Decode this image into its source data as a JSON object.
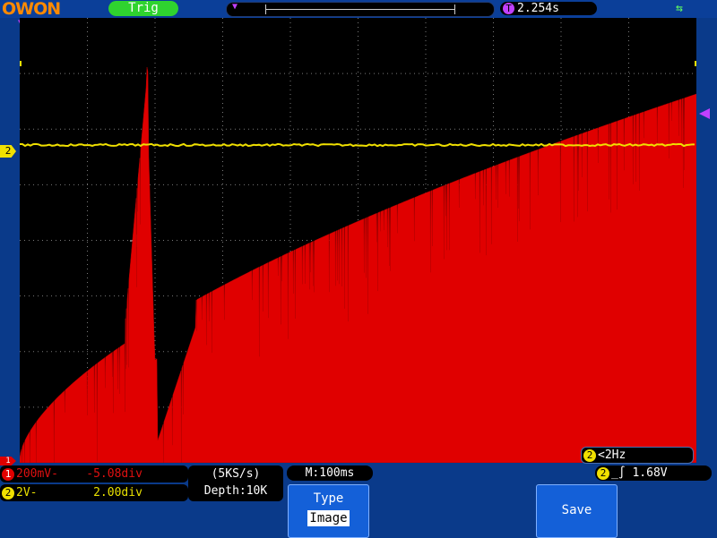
{
  "header": {
    "logo": "OWON",
    "trigger_status": "Trig",
    "trigger_time_offset": "2.254s",
    "trigger_marker_label": "T"
  },
  "channels": {
    "ch1": {
      "number": "1",
      "scale": "200mV-",
      "position": "-5.08div",
      "color": "#e00000"
    },
    "ch2": {
      "number": "2",
      "scale": "2V-",
      "position": "2.00div",
      "color": "#f0e000"
    }
  },
  "acquisition": {
    "sample_rate": "(5KS/s)",
    "depth": "Depth:10K",
    "timebase": "M:100ms"
  },
  "trigger": {
    "source": "2",
    "level": "1.68V",
    "frequency": "<2Hz"
  },
  "softkeys": {
    "type_label": "Type",
    "type_value": "Image",
    "save_label": "Save"
  },
  "chart_data": {
    "type": "line",
    "grid": true,
    "series": [
      {
        "values_description_omitted": true
      }
    ]
  }
}
